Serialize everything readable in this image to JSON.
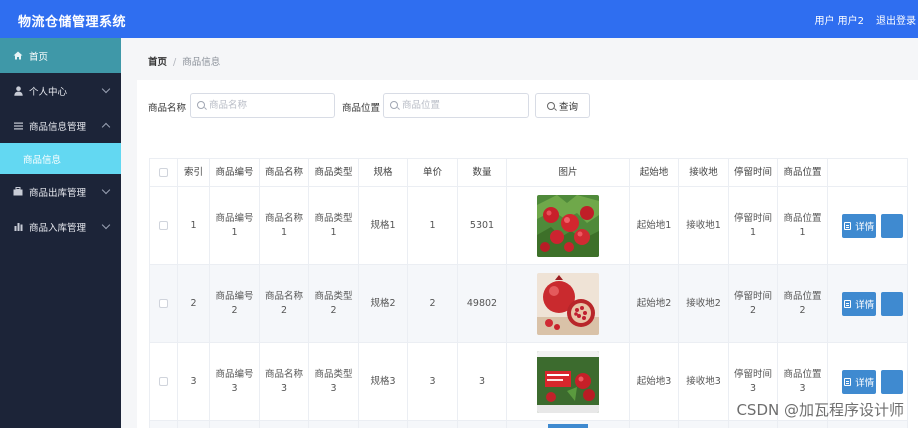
{
  "app": {
    "title": "物流仓储管理系统"
  },
  "topbar": {
    "user_label": "用户 用户2",
    "logout_label": "退出登录"
  },
  "sidebar": {
    "items": [
      {
        "label": "首页",
        "icon": "home-icon"
      },
      {
        "label": "个人中心",
        "icon": "user-icon"
      },
      {
        "label": "商品信息管理",
        "icon": "menu-icon"
      },
      {
        "label": "商品出库管理",
        "icon": "briefcase-icon"
      },
      {
        "label": "商品入库管理",
        "icon": "bar-chart-icon"
      }
    ],
    "sub_item": {
      "label": "商品信息"
    }
  },
  "breadcrumb": {
    "home": "首页",
    "separator": "/",
    "current": "商品信息"
  },
  "search": {
    "name_label": "商品名称",
    "name_placeholder": "商品名称",
    "location_label": "商品位置",
    "location_placeholder": "商品位置",
    "query_label": "查询"
  },
  "table": {
    "headers": [
      "索引",
      "商品编号",
      "商品名称",
      "商品类型",
      "规格",
      "单价",
      "数量",
      "图片",
      "起始地",
      "接收地",
      "停留时间",
      "商品位置"
    ],
    "rows": [
      {
        "index": "1",
        "code": "商品编号1",
        "name": "商品名称1",
        "type": "商品类型1",
        "spec": "规格1",
        "price": "1",
        "quantity": "5301",
        "origin": "起始地1",
        "dest": "接收地1",
        "stay": "停留时间1",
        "location": "商品位置1"
      },
      {
        "index": "2",
        "code": "商品编号2",
        "name": "商品名称2",
        "type": "商品类型2",
        "spec": "规格2",
        "price": "2",
        "quantity": "49802",
        "origin": "起始地2",
        "dest": "接收地2",
        "stay": "停留时间2",
        "location": "商品位置2"
      },
      {
        "index": "3",
        "code": "商品编号3",
        "name": "商品名称3",
        "type": "商品类型3",
        "spec": "规格3",
        "price": "3",
        "quantity": "3",
        "origin": "起始地3",
        "dest": "接收地3",
        "stay": "停留时间3",
        "location": "商品位置3"
      }
    ],
    "detail_label": "详情"
  },
  "watermark": "CSDN @加瓦程序设计师",
  "colors": {
    "topbar": "#2f6ef0",
    "sidebar": "#1c2438",
    "home_active": "#3f98a8",
    "sub_active": "#63d8f2",
    "button": "#3f8ad0"
  }
}
